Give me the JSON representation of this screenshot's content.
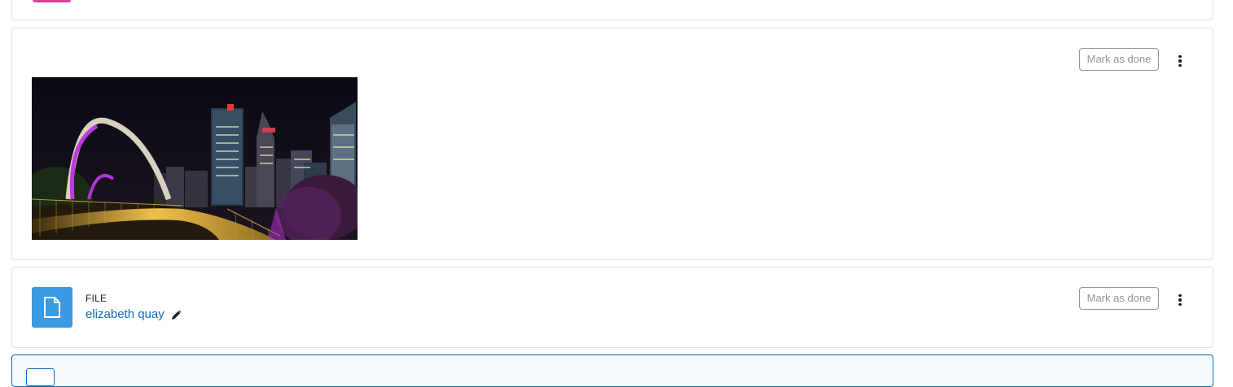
{
  "activities": [
    {
      "type": "image",
      "mark_done_label": "Mark as done"
    },
    {
      "type": "file",
      "type_label": "FILE",
      "name": "elizabeth quay",
      "mark_done_label": "Mark as done"
    }
  ],
  "icons": {
    "file": "file-icon",
    "edit": "pencil-icon",
    "menu": "kebab-menu-icon"
  },
  "colors": {
    "link": "#0f6cbf",
    "file_icon_bg": "#399be2",
    "border": "#dee2e6",
    "accent_pink": "#d64595"
  }
}
